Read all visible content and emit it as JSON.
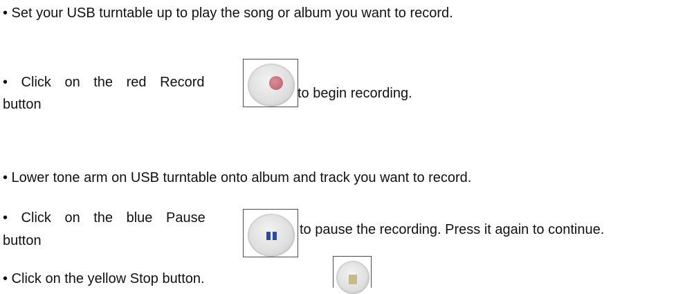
{
  "steps": [
    {
      "text": "• Set your USB turntable up to play the song or album you want to record."
    },
    {
      "line1": "• Click on the red Record",
      "line2": "button",
      "after": "to begin recording."
    },
    {
      "text": "• Lower tone arm on USB turntable onto album and track you want to record."
    },
    {
      "line1": "• Click on the blue Pause",
      "line2": "button",
      "after": "to pause the recording. Press it again to continue."
    },
    {
      "text": "• Click on the yellow Stop button."
    }
  ],
  "icons": {
    "record": "record-button-icon",
    "pause": "pause-button-icon",
    "stop": "stop-button-icon"
  },
  "colors": {
    "record_dot": "#c56b76",
    "pause_bars": "#2b4aa0",
    "stop_square": "#c8bb8a"
  }
}
